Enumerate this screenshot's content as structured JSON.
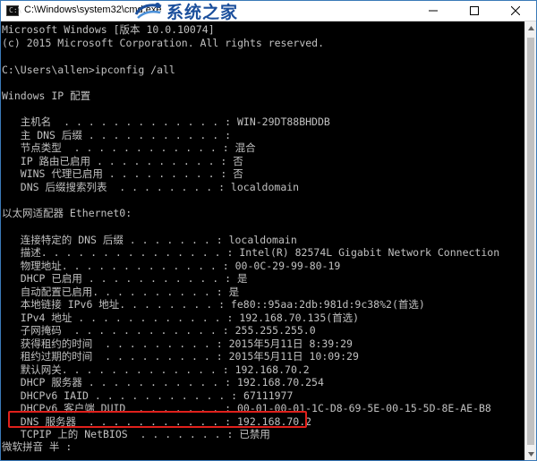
{
  "window": {
    "title": "C:\\Windows\\system32\\cmd.exe",
    "watermark": "系统之家",
    "accent_color": "#e0201b"
  },
  "controls": {
    "minimize_icon": "minimize-icon",
    "maximize_icon": "maximize-icon",
    "close_icon": "close-icon"
  },
  "console": {
    "lines": [
      "Microsoft Windows [版本 10.0.10074]",
      "(c) 2015 Microsoft Corporation. All rights reserved.",
      "",
      "C:\\Users\\allen>ipconfig /all",
      "",
      "Windows IP 配置",
      "",
      "   主机名  . . . . . . . . . . . . . : WIN-29DT88BHDDB",
      "   主 DNS 后缀 . . . . . . . . . . . :",
      "   节点类型  . . . . . . . . . . . . : 混合",
      "   IP 路由已启用 . . . . . . . . . . : 否",
      "   WINS 代理已启用 . . . . . . . . . : 否",
      "   DNS 后缀搜索列表  . . . . . . . . : localdomain",
      "",
      "以太网适配器 Ethernet0:",
      "",
      "   连接特定的 DNS 后缀 . . . . . . . : localdomain",
      "   描述. . . . . . . . . . . . . . . : Intel(R) 82574L Gigabit Network Connection",
      "   物理地址. . . . . . . . . . . . . : 00-0C-29-99-80-19",
      "   DHCP 已启用 . . . . . . . . . . . : 是",
      "   自动配置已启用. . . . . . . . . . : 是",
      "   本地链接 IPv6 地址. . . . . . . . : fe80::95aa:2db:981d:9c38%2(首选)",
      "   IPv4 地址 . . . . . . . . . . . . : 192.168.70.135(首选)",
      "   子网掩码  . . . . . . . . . . . . : 255.255.255.0",
      "   获得租约的时间  . . . . . . . . . : 2015年5月11日 8:39:29",
      "   租约过期的时间  . . . . . . . . . : 2015年5月11日 10:09:29",
      "   默认网关. . . . . . . . . . . . . : 192.168.70.2",
      "   DHCP 服务器 . . . . . . . . . . . : 192.168.70.254",
      "   DHCPv6 IAID . . . . . . . . . . . : 67111977",
      "   DHCPv6 客户端 DUID  . . . . . . . : 00-01-00-01-1C-D8-69-5E-00-15-5D-8E-AE-B8",
      "   DNS 服务器  . . . . . . . . . . . : 192.168.70.2",
      "   TCPIP 上的 NetBIOS  . . . . . . . : 已禁用",
      "微软拼音 半 :"
    ]
  }
}
